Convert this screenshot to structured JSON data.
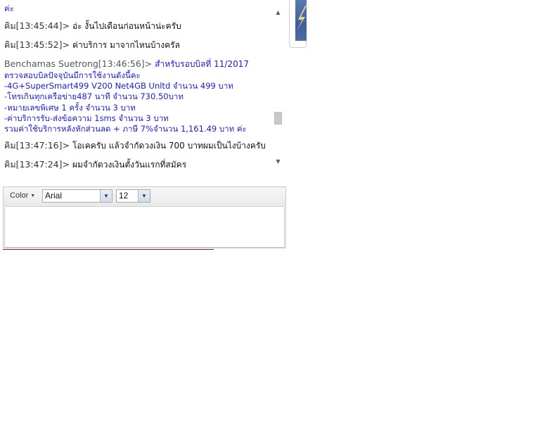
{
  "chat": {
    "cut_top": "ค่ะ",
    "messages": [
      {
        "who": "คิม[13:45:44]> ",
        "text": "อ่ะ งั้นไปเดือนก่อนหน้าน่ะครับ"
      },
      {
        "who": "คิม[13:45:52]> ",
        "text": "ค่าบริการ มาจากไหนบ้างครัล"
      }
    ],
    "agent": {
      "who": "Benchamas Suetrong[13:46:56]> ",
      "head": "สำหรับรอบบิลที่ 11/2017",
      "lines": [
        "ตรวจสอบบิลปัจจุบันมีการใช้งานดังนี้คะ",
        "-4G+SuperSmart499 V200 Net4GB Unltd จำนวน 499 บาท",
        "-โทรเกินทุกเครือข่าย487 นาที จำนวน 730.50บาท",
        "-หมายเลขพิเศษ 1 ครั้ง จำนวน 3 บาท",
        "-ค่าบริการรับ-ส่งข้อความ 1sms จำนวน 3 บาท",
        "รวมค่าใช้บริการหลังหักส่วนลด + ภาษี 7%จำนวน 1,161.49 บาท ค่ะ"
      ]
    },
    "messages_after": [
      {
        "who": "คิม[13:47:16]> ",
        "text": "โอเคครับ แล้วจำกัดวงเงิน 700 บาทผมเป็นไงบ้างครับ"
      },
      {
        "who": "คิม[13:47:24]> ",
        "text": "ผมจำกัดวงเงินตั้งวันแรกที่สมัคร"
      }
    ]
  },
  "scrollbar": {
    "up_icon": "▲",
    "down_icon": "▼",
    "position": 0.75
  },
  "toolbar": {
    "color_label": "Color",
    "color_caret": "▼",
    "font_value": "Arial",
    "size_value": "12",
    "dropdown_icon": "▼"
  },
  "colors": {
    "agent_text": "#1a1adc",
    "divider": "#8b1a1a"
  }
}
